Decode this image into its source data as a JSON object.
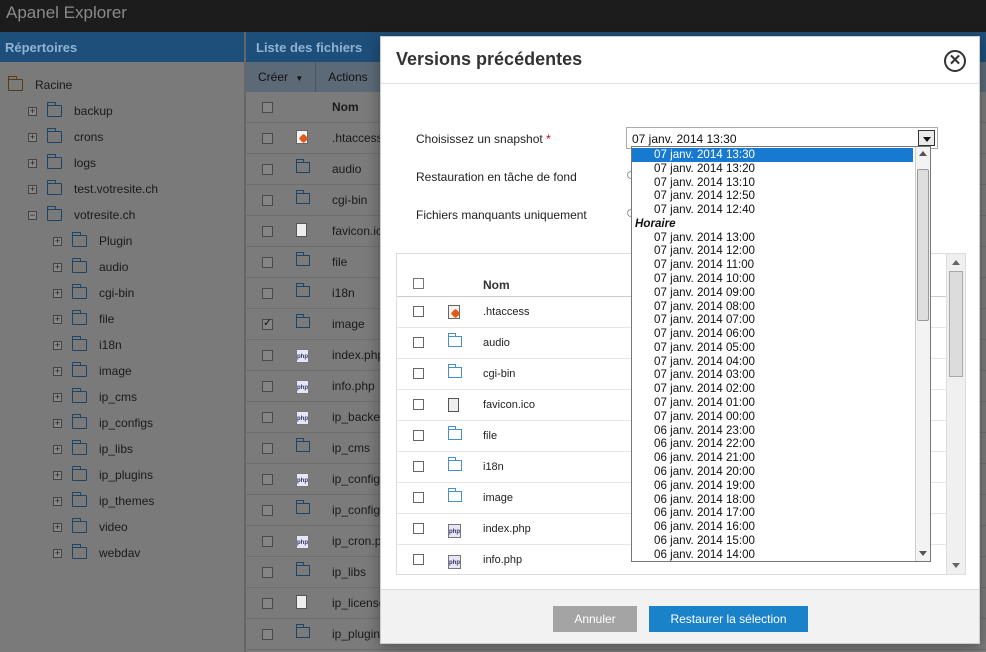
{
  "app": {
    "title": "Apanel Explorer"
  },
  "left_panel": {
    "header": "Répertoires",
    "tree": [
      {
        "label": "Racine",
        "expander": "",
        "level": 0,
        "root": true
      },
      {
        "label": "backup",
        "expander": "+",
        "level": 1
      },
      {
        "label": "crons",
        "expander": "+",
        "level": 1
      },
      {
        "label": "logs",
        "expander": "+",
        "level": 1
      },
      {
        "label": "test.votresite.ch",
        "expander": "+",
        "level": 1
      },
      {
        "label": "votresite.ch",
        "expander": "−",
        "level": 1
      },
      {
        "label": "Plugin",
        "expander": "+",
        "level": 2
      },
      {
        "label": "audio",
        "expander": "+",
        "level": 2
      },
      {
        "label": "cgi-bin",
        "expander": "+",
        "level": 2
      },
      {
        "label": "file",
        "expander": "+",
        "level": 2
      },
      {
        "label": "i18n",
        "expander": "+",
        "level": 2
      },
      {
        "label": "image",
        "expander": "+",
        "level": 2
      },
      {
        "label": "ip_cms",
        "expander": "+",
        "level": 2
      },
      {
        "label": "ip_configs",
        "expander": "+",
        "level": 2
      },
      {
        "label": "ip_libs",
        "expander": "+",
        "level": 2
      },
      {
        "label": "ip_plugins",
        "expander": "+",
        "level": 2
      },
      {
        "label": "ip_themes",
        "expander": "+",
        "level": 2
      },
      {
        "label": "video",
        "expander": "+",
        "level": 2
      },
      {
        "label": "webdav",
        "expander": "+",
        "level": 2
      }
    ]
  },
  "mid_panel": {
    "header": "Liste des fichiers",
    "toolbar": {
      "create": "Créer",
      "actions": "Actions"
    },
    "column_name": "Nom",
    "rows": [
      {
        "name": ".htaccess",
        "icon": "htaccess",
        "checked": false
      },
      {
        "name": "audio",
        "icon": "folder",
        "checked": false
      },
      {
        "name": "cgi-bin",
        "icon": "folder",
        "checked": false
      },
      {
        "name": "favicon.ico",
        "icon": "file",
        "checked": false
      },
      {
        "name": "file",
        "icon": "folder",
        "checked": false
      },
      {
        "name": "i18n",
        "icon": "folder",
        "checked": false
      },
      {
        "name": "image",
        "icon": "folder",
        "checked": true
      },
      {
        "name": "index.php",
        "icon": "php",
        "checked": false
      },
      {
        "name": "info.php",
        "icon": "php",
        "checked": false
      },
      {
        "name": "ip_backer",
        "icon": "php",
        "checked": false
      },
      {
        "name": "ip_cms",
        "icon": "folder",
        "checked": false
      },
      {
        "name": "ip_config.",
        "icon": "php",
        "checked": false
      },
      {
        "name": "ip_configs",
        "icon": "folder",
        "checked": false
      },
      {
        "name": "ip_cron.pl",
        "icon": "php",
        "checked": false
      },
      {
        "name": "ip_libs",
        "icon": "folder",
        "checked": false
      },
      {
        "name": "ip_license",
        "icon": "file",
        "checked": false
      },
      {
        "name": "ip_plugins",
        "icon": "folder",
        "checked": false
      }
    ]
  },
  "modal": {
    "title": "Versions précédentes",
    "close": "✕",
    "labels": {
      "snapshot": "Choisissez un snapshot",
      "required": "*",
      "background": "Restauration en tâche de fond",
      "missing_only": "Fichiers manquants uniquement"
    },
    "selected_snapshot": "07 janv. 2014 13:30",
    "table": {
      "column_name": "Nom",
      "rows": [
        {
          "name": ".htaccess",
          "icon": "htaccess"
        },
        {
          "name": "audio",
          "icon": "folder"
        },
        {
          "name": "cgi-bin",
          "icon": "folder"
        },
        {
          "name": "favicon.ico",
          "icon": "file"
        },
        {
          "name": "file",
          "icon": "folder"
        },
        {
          "name": "i18n",
          "icon": "folder"
        },
        {
          "name": "image",
          "icon": "folder"
        },
        {
          "name": "index.php",
          "icon": "php"
        },
        {
          "name": "info.php",
          "icon": "php"
        }
      ]
    },
    "buttons": {
      "cancel": "Annuler",
      "restore": "Restaurer la sélection"
    }
  },
  "dropdown": {
    "items": [
      {
        "type": "option",
        "label": "07 janv. 2014 13:30",
        "selected": true
      },
      {
        "type": "option",
        "label": "07 janv. 2014 13:20"
      },
      {
        "type": "option",
        "label": "07 janv. 2014 13:10"
      },
      {
        "type": "option",
        "label": "07 janv. 2014 12:50"
      },
      {
        "type": "option",
        "label": "07 janv. 2014 12:40"
      },
      {
        "type": "group",
        "label": "Horaire"
      },
      {
        "type": "option",
        "label": "07 janv. 2014 13:00"
      },
      {
        "type": "option",
        "label": "07 janv. 2014 12:00"
      },
      {
        "type": "option",
        "label": "07 janv. 2014 11:00"
      },
      {
        "type": "option",
        "label": "07 janv. 2014 10:00"
      },
      {
        "type": "option",
        "label": "07 janv. 2014 09:00"
      },
      {
        "type": "option",
        "label": "07 janv. 2014 08:00"
      },
      {
        "type": "option",
        "label": "07 janv. 2014 07:00"
      },
      {
        "type": "option",
        "label": "07 janv. 2014 06:00"
      },
      {
        "type": "option",
        "label": "07 janv. 2014 05:00"
      },
      {
        "type": "option",
        "label": "07 janv. 2014 04:00"
      },
      {
        "type": "option",
        "label": "07 janv. 2014 03:00"
      },
      {
        "type": "option",
        "label": "07 janv. 2014 02:00"
      },
      {
        "type": "option",
        "label": "07 janv. 2014 01:00"
      },
      {
        "type": "option",
        "label": "07 janv. 2014 00:00"
      },
      {
        "type": "option",
        "label": "06 janv. 2014 23:00"
      },
      {
        "type": "option",
        "label": "06 janv. 2014 22:00"
      },
      {
        "type": "option",
        "label": "06 janv. 2014 21:00"
      },
      {
        "type": "option",
        "label": "06 janv. 2014 20:00"
      },
      {
        "type": "option",
        "label": "06 janv. 2014 19:00"
      },
      {
        "type": "option",
        "label": "06 janv. 2014 18:00"
      },
      {
        "type": "option",
        "label": "06 janv. 2014 17:00"
      },
      {
        "type": "option",
        "label": "06 janv. 2014 16:00"
      },
      {
        "type": "option",
        "label": "06 janv. 2014 15:00"
      },
      {
        "type": "option",
        "label": "06 janv. 2014 14:00"
      }
    ]
  }
}
